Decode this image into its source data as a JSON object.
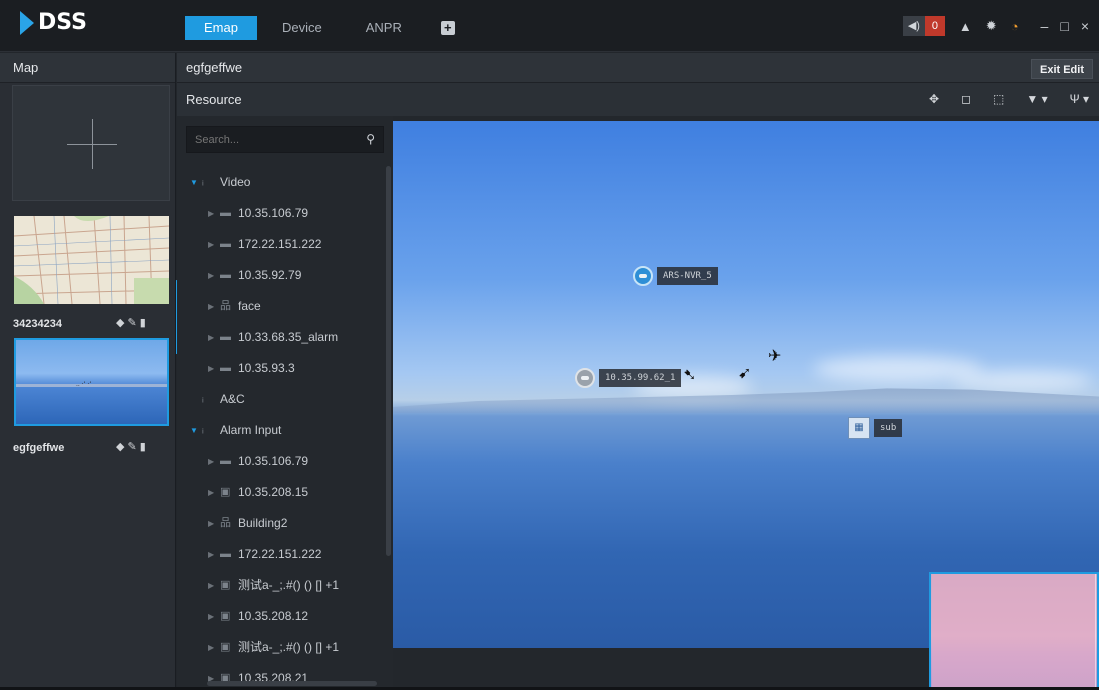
{
  "app": {
    "logo_text": "DSS",
    "accent": "#1f9be0"
  },
  "topbar": {
    "tabs": [
      {
        "label": "Emap",
        "active": true
      },
      {
        "label": "Device",
        "active": false
      },
      {
        "label": "ANPR",
        "active": false
      }
    ],
    "alarm_count": "0",
    "speaker_icon": "speaker-icon",
    "user_icon": "user-icon",
    "settings_icon": "gear-icon",
    "monitor_icon": "gauge-icon",
    "minimize": "–",
    "maximize": "□",
    "close": "×"
  },
  "maps_panel": {
    "title": "Map",
    "maps": [
      {
        "name": "34234234"
      },
      {
        "name": "egfgeffwe",
        "selected": true
      }
    ]
  },
  "middle": {
    "map_name": "egfgeffwe",
    "resource_title": "Resource",
    "search_placeholder": "Search...",
    "tree": [
      {
        "level": 0,
        "label": "Video",
        "expanded": true,
        "icon": "group-icon"
      },
      {
        "level": 1,
        "label": "10.35.106.79",
        "icon": "nvr-icon"
      },
      {
        "level": 1,
        "label": "172.22.151.222",
        "icon": "nvr-icon"
      },
      {
        "level": 1,
        "label": "10.35.92.79",
        "icon": "nvr-icon"
      },
      {
        "level": 1,
        "label": "face",
        "icon": "org-icon"
      },
      {
        "level": 1,
        "label": "10.33.68.35_alarm",
        "icon": "nvr-icon"
      },
      {
        "level": 1,
        "label": "10.35.93.3",
        "icon": "nvr-icon"
      },
      {
        "level": 0,
        "label": "A&C",
        "expanded": false,
        "icon": "group-icon"
      },
      {
        "level": 0,
        "label": "Alarm Input",
        "expanded": true,
        "icon": "group-icon"
      },
      {
        "level": 1,
        "label": "10.35.106.79",
        "icon": "nvr-icon"
      },
      {
        "level": 1,
        "label": "10.35.208.15",
        "icon": "panel-icon"
      },
      {
        "level": 1,
        "label": "Building2",
        "icon": "org-icon"
      },
      {
        "level": 1,
        "label": "172.22.151.222",
        "icon": "nvr-icon"
      },
      {
        "level": 1,
        "label": "测试a-_;.#() () [] +1",
        "icon": "panel-icon"
      },
      {
        "level": 1,
        "label": "10.35.208.12",
        "icon": "panel-icon"
      },
      {
        "level": 1,
        "label": "测试a-_;.#() () [] +1",
        "icon": "panel-icon"
      },
      {
        "level": 1,
        "label": "10.35.208.21",
        "icon": "panel-icon"
      }
    ]
  },
  "editor": {
    "exit_label": "Exit Edit",
    "tools": [
      "move-icon",
      "select-box-icon",
      "select-icon",
      "filter-icon",
      "antenna-icon"
    ],
    "markers": [
      {
        "label": "ARS-NVR_5",
        "color": "blue"
      },
      {
        "label": "10.35.99.62_1",
        "color": "gray"
      },
      {
        "label": "sub",
        "type": "submap"
      }
    ]
  }
}
